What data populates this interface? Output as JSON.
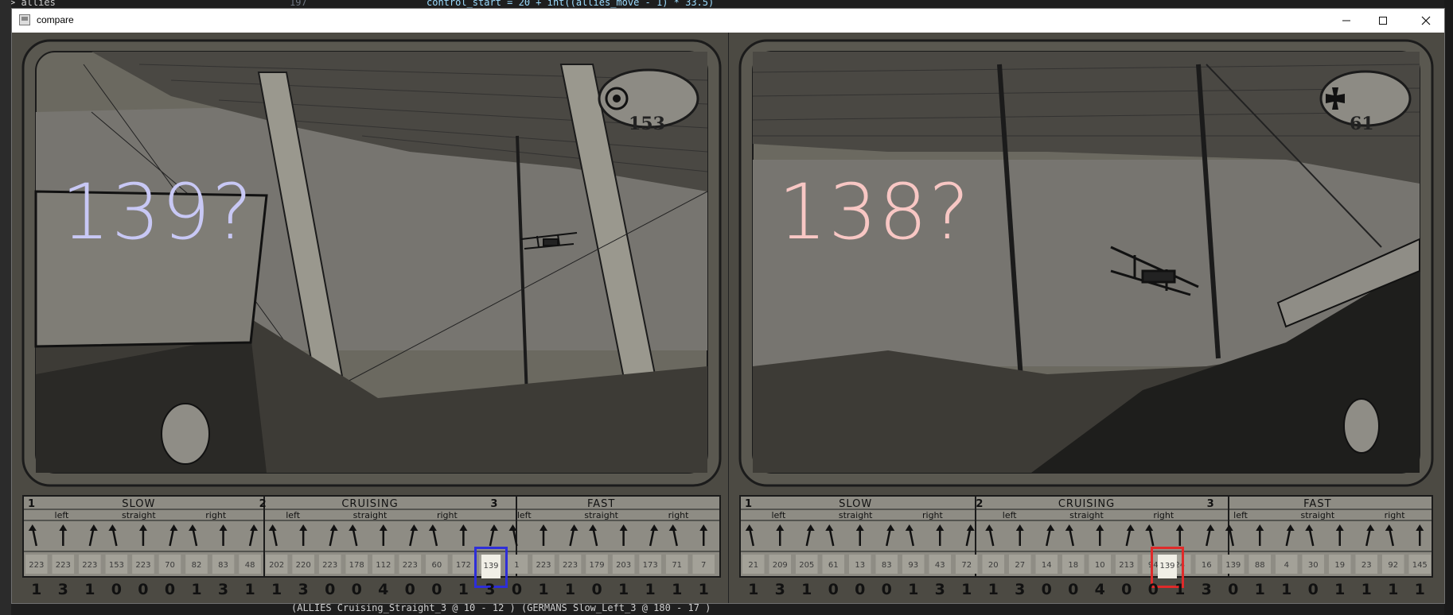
{
  "editor": {
    "folder_label": "> allies",
    "line_number": "197",
    "code_line": "control_start = 20 + int((allies_move - 1) * 33.5)",
    "status_line": "(ALLIES Cruising_Straight_3 @ 10 - 12 ) (GERMANS Slow_Left_3 @ 180 - 17 )"
  },
  "window": {
    "title": "compare",
    "minimize_icon": "minimize-icon",
    "maximize_icon": "maximize-icon",
    "close_icon": "close-icon"
  },
  "left_card": {
    "badge_number": "153",
    "badge_symbol": "roundel",
    "guess_text": "139?",
    "guess_color": "#c8c8f5",
    "highlight_color": "#2e2ed8",
    "speed_sections": [
      "SLOW",
      "CRUISING",
      "FAST"
    ],
    "speed_numbers": [
      "1",
      "2",
      "3"
    ],
    "section_labels": [
      "left",
      "straight",
      "right",
      "left",
      "straight",
      "right",
      "left",
      "straight",
      "right"
    ],
    "values": [
      "223",
      "223",
      "223",
      "153",
      "223",
      "70",
      "82",
      "83",
      "48",
      "202",
      "220",
      "223",
      "178",
      "112",
      "223",
      "60",
      "172",
      "139",
      "1",
      "223",
      "223",
      "179",
      "203",
      "173",
      "71",
      "7"
    ],
    "highlight_value": "139",
    "digits": [
      "1",
      "3",
      "1",
      "0",
      "0",
      "0",
      "1",
      "3",
      "1",
      "1",
      "3",
      "0",
      "0",
      "4",
      "0",
      "0",
      "1",
      "3",
      "0",
      "1",
      "1",
      "0",
      "1",
      "1",
      "1",
      "1"
    ]
  },
  "right_card": {
    "badge_number": "61",
    "badge_symbol": "iron-cross",
    "guess_text": "138?",
    "guess_color": "#f8c7c4",
    "highlight_color": "#e02a2a",
    "speed_sections": [
      "SLOW",
      "CRUISING",
      "FAST"
    ],
    "speed_numbers": [
      "1",
      "2",
      "3"
    ],
    "section_labels": [
      "left",
      "straight",
      "right",
      "left",
      "straight",
      "right",
      "left",
      "straight",
      "right"
    ],
    "values": [
      "21",
      "209",
      "205",
      "61",
      "13",
      "83",
      "93",
      "43",
      "72",
      "20",
      "27",
      "14",
      "18",
      "10",
      "213",
      "94",
      "24",
      "16",
      "139",
      "88",
      "4",
      "30",
      "19",
      "23",
      "92",
      "145"
    ],
    "highlight_value": "139",
    "digits": [
      "1",
      "3",
      "1",
      "0",
      "0",
      "0",
      "1",
      "3",
      "1",
      "1",
      "3",
      "0",
      "0",
      "4",
      "0",
      "0",
      "1",
      "3",
      "0",
      "1",
      "1",
      "0",
      "1",
      "1",
      "1",
      "1"
    ]
  }
}
